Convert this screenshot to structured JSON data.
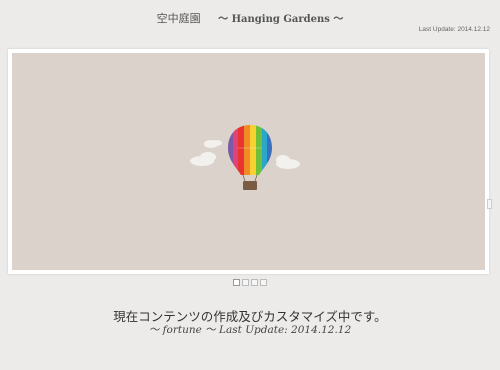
{
  "header": {
    "title_jp": "空中庭園",
    "title_en": "〜 Hanging Gardens 〜",
    "last_update": "Last Update: 2014.12.12"
  },
  "slider": {
    "slide_count": 4,
    "active_index": 0,
    "slide_bg": "#dad2cb"
  },
  "footer": {
    "status": "現在コンテンツの作成及びカスタマイズ中です。",
    "credit": "〜 fortune 〜 Last Update: 2014.12.12"
  }
}
